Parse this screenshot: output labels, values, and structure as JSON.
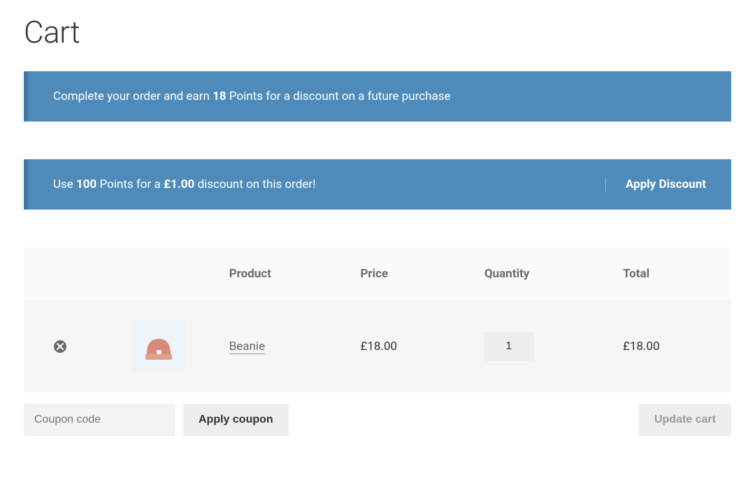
{
  "page": {
    "title": "Cart"
  },
  "notices": {
    "earn": {
      "prefix": "Complete your order and earn ",
      "points": "18",
      "suffix": " Points for a discount on a future purchase"
    },
    "redeem": {
      "prefix": "Use ",
      "points": "100",
      "middle": " Points for a ",
      "amount": "£1.00",
      "suffix": " discount on this order!",
      "action": "Apply Discount"
    }
  },
  "table": {
    "headers": {
      "product": "Product",
      "price": "Price",
      "quantity": "Quantity",
      "total": "Total"
    },
    "rows": [
      {
        "name": "Beanie",
        "price": "£18.00",
        "quantity": "1",
        "total": "£18.00"
      }
    ]
  },
  "coupon": {
    "placeholder": "Coupon code",
    "apply": "Apply coupon"
  },
  "update": {
    "label": "Update cart"
  }
}
